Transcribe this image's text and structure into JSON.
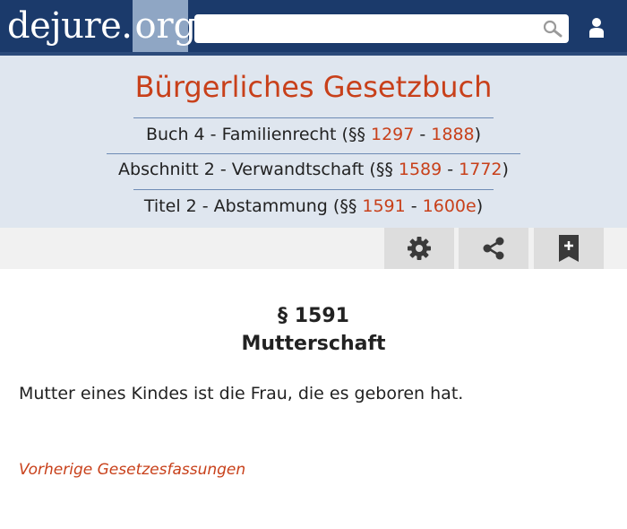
{
  "header": {
    "logo_part1": "dejure.",
    "logo_part2": "org",
    "search_placeholder": "",
    "colors": {
      "bar": "#1b3a6b",
      "accent": "#c8401a",
      "logo_tile": "#8fa6c4"
    }
  },
  "breadcrumb": {
    "title": "Bürgerliches Gesetzbuch",
    "book": {
      "prefix": "Buch 4 - Familienrecht (§§ ",
      "from": "1297",
      "sep": " - ",
      "to": "1888",
      "suffix": ")"
    },
    "section": {
      "prefix": "Abschnitt 2 - Verwandtschaft (§§ ",
      "from": "1589",
      "sep": " - ",
      "to": "1772",
      "suffix": ")"
    },
    "title2": {
      "prefix": "Titel 2 - Abstammung (§§ ",
      "from": "1591",
      "sep": " - ",
      "to": "1600e",
      "suffix": ")"
    }
  },
  "toolbar": {
    "icons": [
      "gear-icon",
      "share-icon",
      "bookmark-add-icon"
    ]
  },
  "paragraph": {
    "number": "§ 1591",
    "title": "Mutterschaft",
    "text": "Mutter eines Kindes ist die Frau, die es geboren hat."
  },
  "links": {
    "previous_versions": "Vorherige Gesetzesfassungen"
  }
}
